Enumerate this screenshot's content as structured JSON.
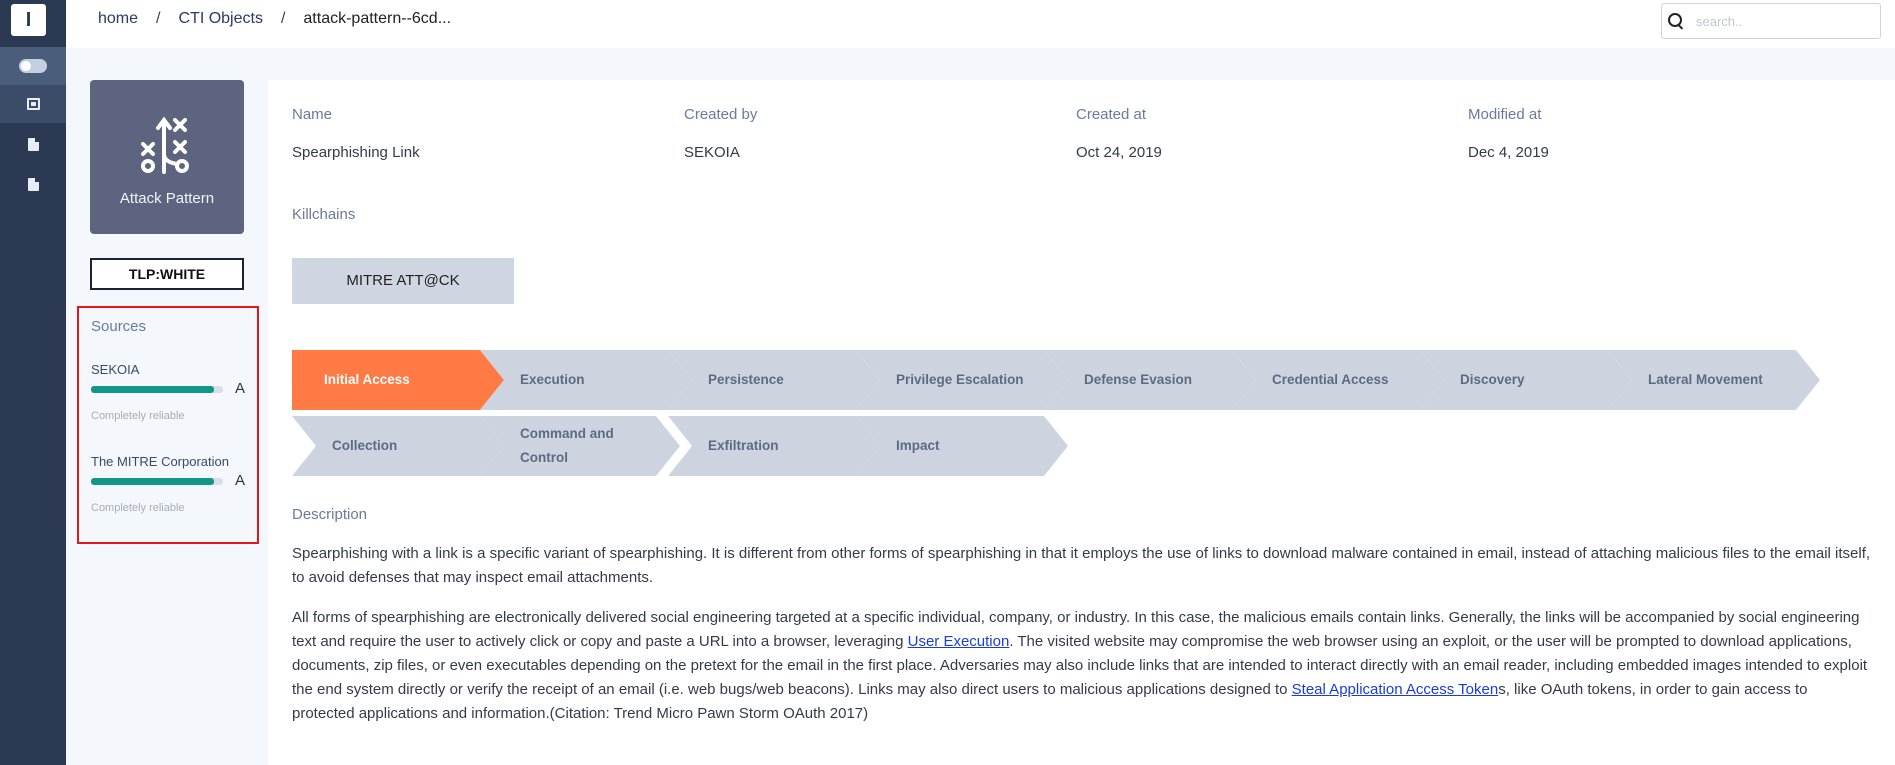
{
  "sidebar": {
    "logo": "I",
    "items": [
      {
        "icon": "toggle-icon"
      },
      {
        "icon": "stack-icon"
      },
      {
        "icon": "document-icon"
      },
      {
        "icon": "document-icon"
      }
    ]
  },
  "breadcrumb": {
    "items": [
      "home",
      "CTI Objects",
      "attack-pattern--6cd..."
    ],
    "separator": "/"
  },
  "search": {
    "placeholder": "search..",
    "value": ""
  },
  "object": {
    "type_label": "Attack Pattern",
    "type_icon": "attack-pattern-icon",
    "tlp": "TLP:WHITE"
  },
  "sources": {
    "title": "Sources",
    "items": [
      {
        "name": "SEKOIA",
        "grade": "A",
        "reliability": "Completely reliable",
        "score": 0.93
      },
      {
        "name": "The MITRE Corporation",
        "grade": "A",
        "reliability": "Completely reliable",
        "score": 0.93
      }
    ]
  },
  "meta": {
    "name_label": "Name",
    "name_value": "Spearphishing Link",
    "created_by_label": "Created by",
    "created_by_value": "SEKOIA",
    "created_at_label": "Created at",
    "created_at_value": "Oct 24, 2019",
    "modified_at_label": "Modified at",
    "modified_at_value": "Dec 4, 2019"
  },
  "killchains": {
    "label": "Killchains",
    "button": "MITRE ATT@CK",
    "phases": [
      {
        "label": "Initial Access",
        "active": true
      },
      {
        "label": "Execution",
        "active": false
      },
      {
        "label": "Persistence",
        "active": false
      },
      {
        "label": "Privilege Escalation",
        "active": false
      },
      {
        "label": "Defense Evasion",
        "active": false
      },
      {
        "label": "Credential Access",
        "active": false
      },
      {
        "label": "Discovery",
        "active": false
      },
      {
        "label": "Lateral Movement",
        "active": false
      },
      {
        "label": "Collection",
        "active": false
      },
      {
        "label": "Command and Control",
        "active": false
      },
      {
        "label": "Exfiltration",
        "active": false
      },
      {
        "label": "Impact",
        "active": false
      }
    ]
  },
  "description": {
    "label": "Description",
    "para1": "Spearphishing with a link is a specific variant of spearphishing. It is different from other forms of spearphishing in that it employs the use of links to download malware contained in email, instead of attaching malicious files to the email itself, to avoid defenses that may inspect email attachments.",
    "para2_a": "All forms of spearphishing are electronically delivered social engineering targeted at a specific individual, company, or industry. In this case, the malicious emails contain links. Generally, the links will be accompanied by social engineering text and require the user to actively click or copy and paste a URL into a browser, leveraging ",
    "link1": "User Execution",
    "para2_b": ". The visited website may compromise the web browser using an exploit, or the user will be prompted to download applications, documents, zip files, or even executables depending on the pretext for the email in the first place. Adversaries may also include links that are intended to interact directly with an email reader, including embedded images intended to exploit the end system directly or verify the receipt of an email (i.e. web bugs/web beacons). Links may also direct users to malicious applications  designed to ",
    "link2": "Steal Application Access Token",
    "para2_c": "s, like OAuth tokens, in order to gain access to protected applications and information.(Citation: Trend Micro Pawn Storm OAuth 2017)"
  },
  "colors": {
    "sidebar": "#2b3a52",
    "active_phase": "#ff7a45",
    "phase": "#cdd4e0",
    "reliability_bar": "#12968a",
    "highlight_border": "#e01818"
  }
}
